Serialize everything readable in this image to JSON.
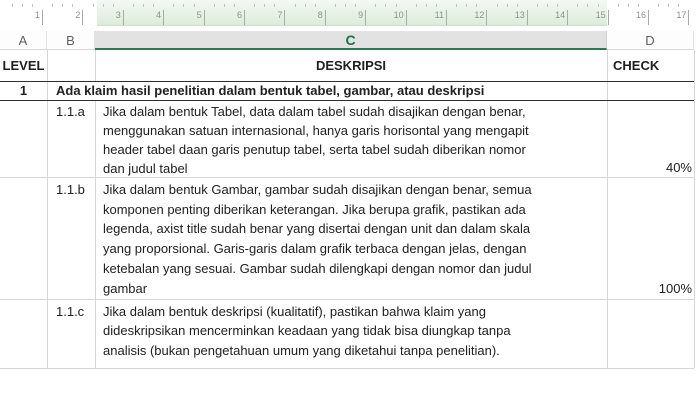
{
  "ruler": {
    "numbers": [
      "1",
      "2",
      "3",
      "4",
      "5",
      "6",
      "7",
      "8",
      "9",
      "10",
      "11",
      "12",
      "13",
      "14",
      "15",
      "16",
      "17"
    ]
  },
  "columns": {
    "labels": [
      "A",
      "B",
      "C",
      "D"
    ],
    "selected": "C"
  },
  "table": {
    "header": {
      "level": "LEVEL",
      "deskripsi": "DESKRIPSI",
      "check": "CHECK"
    },
    "row1": {
      "level": "1",
      "text": "Ada klaim hasil penelitian dalam bentuk tabel, gambar, atau deskripsi"
    },
    "row11a": {
      "code": "1.1.a",
      "lines": [
        "Jika dalam bentuk Tabel, data dalam tabel sudah disajikan dengan benar,",
        "menggunakan satuan internasional, hanya garis horisontal yang mengapit",
        "header tabel daan garis penutup tabel, serta tabel sudah diberikan nomor",
        "dan judul tabel"
      ],
      "check": "40%"
    },
    "row11b": {
      "code": "1.1.b",
      "lines": [
        "Jika dalam bentuk Gambar, gambar sudah disajikan dengan benar, semua",
        "komponen penting diberikan keterangan. Jika berupa grafik, pastikan ada",
        "legenda, axist title sudah benar yang disertai dengan unit dan dalam skala",
        "yang proporsional. Garis-garis dalam grafik terbaca dengan jelas, dengan",
        "ketebalan yang sesuai. Gambar sudah dilengkapi dengan nomor dan judul",
        "gambar"
      ],
      "check": "100%"
    },
    "row11c": {
      "code": "1.1.c",
      "lines": [
        "Jika dalam bentuk deskripsi (kualitatif), pastikan bahwa klaim yang",
        "dideskripsikan mencerminkan keadaan yang tidak bisa diungkap tanpa",
        "analisis (bukan pengetahuan umum yang diketahui tanpa penelitian)."
      ]
    }
  },
  "colors": {
    "accent_green": "#1f7145",
    "selected_header_underline": "#2c7a52",
    "selected_header_bg": "#e2e2e2",
    "border_dark": "#2f2f2f",
    "border_light": "#d6d6d6"
  }
}
